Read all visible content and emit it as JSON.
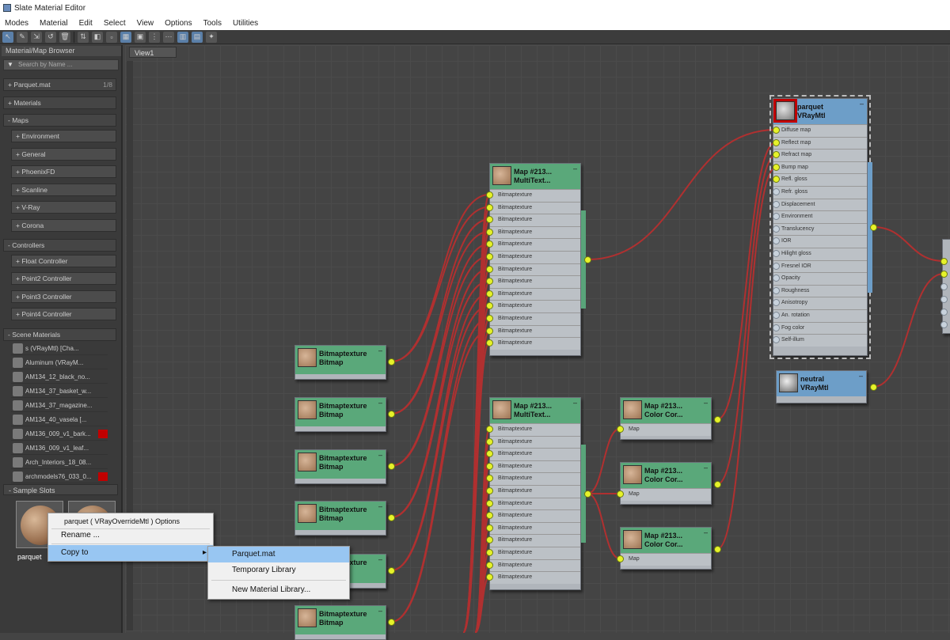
{
  "window": {
    "title": "Slate Material Editor"
  },
  "menu": [
    "Modes",
    "Material",
    "Edit",
    "Select",
    "View",
    "Options",
    "Tools",
    "Utilities"
  ],
  "browser": {
    "header": "Material/Map Browser",
    "search_placeholder": "Search by Name ...",
    "library": {
      "label": "+ Parquet.mat",
      "count": "1/8"
    },
    "materials": "+ Materials",
    "maps": "- Maps",
    "map_groups": [
      "+ Environment",
      "+ General",
      "+ PhoenixFD",
      "+ Scanline",
      "+ V-Ray",
      "+ Corona"
    ],
    "controllers": "- Controllers",
    "controller_groups": [
      "+ Float Controller",
      "+ Point2 Controller",
      "+ Point3 Controller",
      "+ Point4 Controller"
    ],
    "scene_materials": "- Scene Materials",
    "scene_items": [
      "s (VRayMtl) [Cha...",
      "Aluminum (VRayM...",
      "AM134_12_black_no...",
      "AM134_37_basket_w...",
      "AM134_37_magazine...",
      "AM134_40_vasela [...",
      "AM136_009_v1_bark...",
      "AM136_009_v1_leaf...",
      "Arch_Interiors_18_08...",
      "archmodels76_033_0..."
    ],
    "sample_slots": "- Sample Slots",
    "slot_label": "parquet"
  },
  "view": {
    "tab": "View1"
  },
  "nodes": {
    "bitmap_title": "Bitmaptexture",
    "bitmap_sub": "Bitmap",
    "multi_title": "Map #213...",
    "multi_sub": "MultiText...",
    "multi_slot": "Bitmaptexture",
    "cc_title": "Map #213...",
    "cc_sub": "Color Cor...",
    "cc_slot": "Map",
    "vray_title": "parquet",
    "vray_sub": "VRayMtl",
    "vray_slots": [
      "Diffuse map",
      "Reflect map",
      "Refract map",
      "Bump map",
      "Refl. gloss",
      "Refr. gloss",
      "Displacement",
      "Environment",
      "Translucency",
      "IOR",
      "Hilight gloss",
      "Fresnel IOR",
      "Opacity",
      "Roughness",
      "Anisotropy",
      "An. rotation",
      "Fog color",
      "Self-illum"
    ],
    "neutral_title": "neutral",
    "neutral_sub": "VRayMtl"
  },
  "context_menu": {
    "header": "parquet ( VRayOverrideMtl ) Options",
    "rename": "Rename ...",
    "copy_to": "Copy to",
    "submenu": [
      "Parquet.mat",
      "Temporary Library",
      "New Material Library..."
    ]
  },
  "colors": {
    "node_green": "#5aa87a",
    "node_blue": "#6d9ec8",
    "wire": "#b03030",
    "socket": "#e6f22a",
    "highlight": "#98c6f2"
  }
}
